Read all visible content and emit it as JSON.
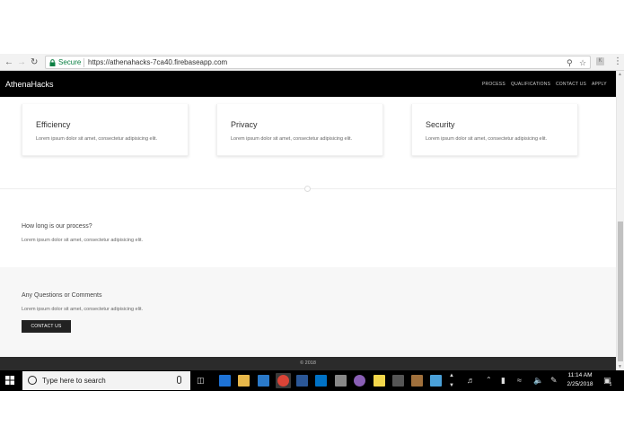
{
  "browser": {
    "secure_label": "Secure",
    "url": "https://athenahacks-7ca40.firebaseapp.com",
    "extension_label": "K"
  },
  "site": {
    "brand": "AthenaHacks",
    "nav": [
      "PROCESS",
      "QUALIFICATIONS",
      "CONTACT US",
      "APPLY"
    ],
    "cards": [
      {
        "title": "Efficiency",
        "text": "Lorem ipsum dolor sit amet, consectetur adipisicing elit."
      },
      {
        "title": "Privacy",
        "text": "Lorem ipsum dolor sit amet, consectetur adipisicing elit."
      },
      {
        "title": "Security",
        "text": "Lorem ipsum dolor sit amet, consectetur adipisicing elit."
      }
    ],
    "process": {
      "title": "How long is our process?",
      "text": "Lorem ipsum dolor sit amet, consectetur adipisicing elit."
    },
    "questions": {
      "title": "Any Questions or Comments",
      "text": "Lorem ipsum dolor sit amet, consectetur adipisicing elit.",
      "button": "CONTACT US"
    },
    "footer": "© 2018"
  },
  "taskbar": {
    "search_placeholder": "Type here to search",
    "time": "11:14 AM",
    "date": "2/25/2018",
    "notification_count": "1",
    "accent": "#0078d7"
  }
}
